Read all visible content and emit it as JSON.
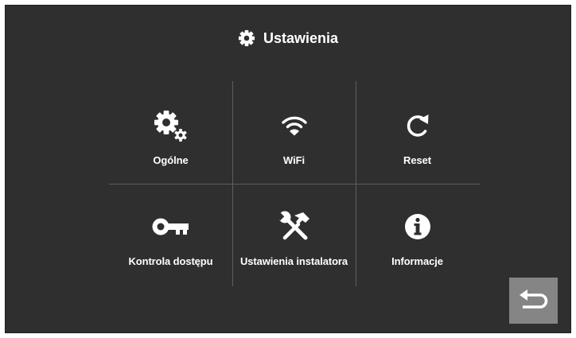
{
  "header": {
    "title": "Ustawienia",
    "icon": "gear-icon"
  },
  "menu": [
    {
      "label": "Ogólne",
      "icon": "gears-icon"
    },
    {
      "label": "WiFi",
      "icon": "wifi-icon"
    },
    {
      "label": "Reset",
      "icon": "refresh-icon"
    },
    {
      "label": "Kontrola dostępu",
      "icon": "key-icon"
    },
    {
      "label": "Ustawienia instalatora",
      "icon": "tools-icon"
    },
    {
      "label": "Informacje",
      "icon": "info-icon"
    }
  ],
  "back_button": {
    "icon": "return-arrow-icon"
  },
  "colors": {
    "background": "#2f2f2f",
    "divider": "#5e5e5e",
    "text": "#ffffff",
    "back_button": "#858585"
  }
}
